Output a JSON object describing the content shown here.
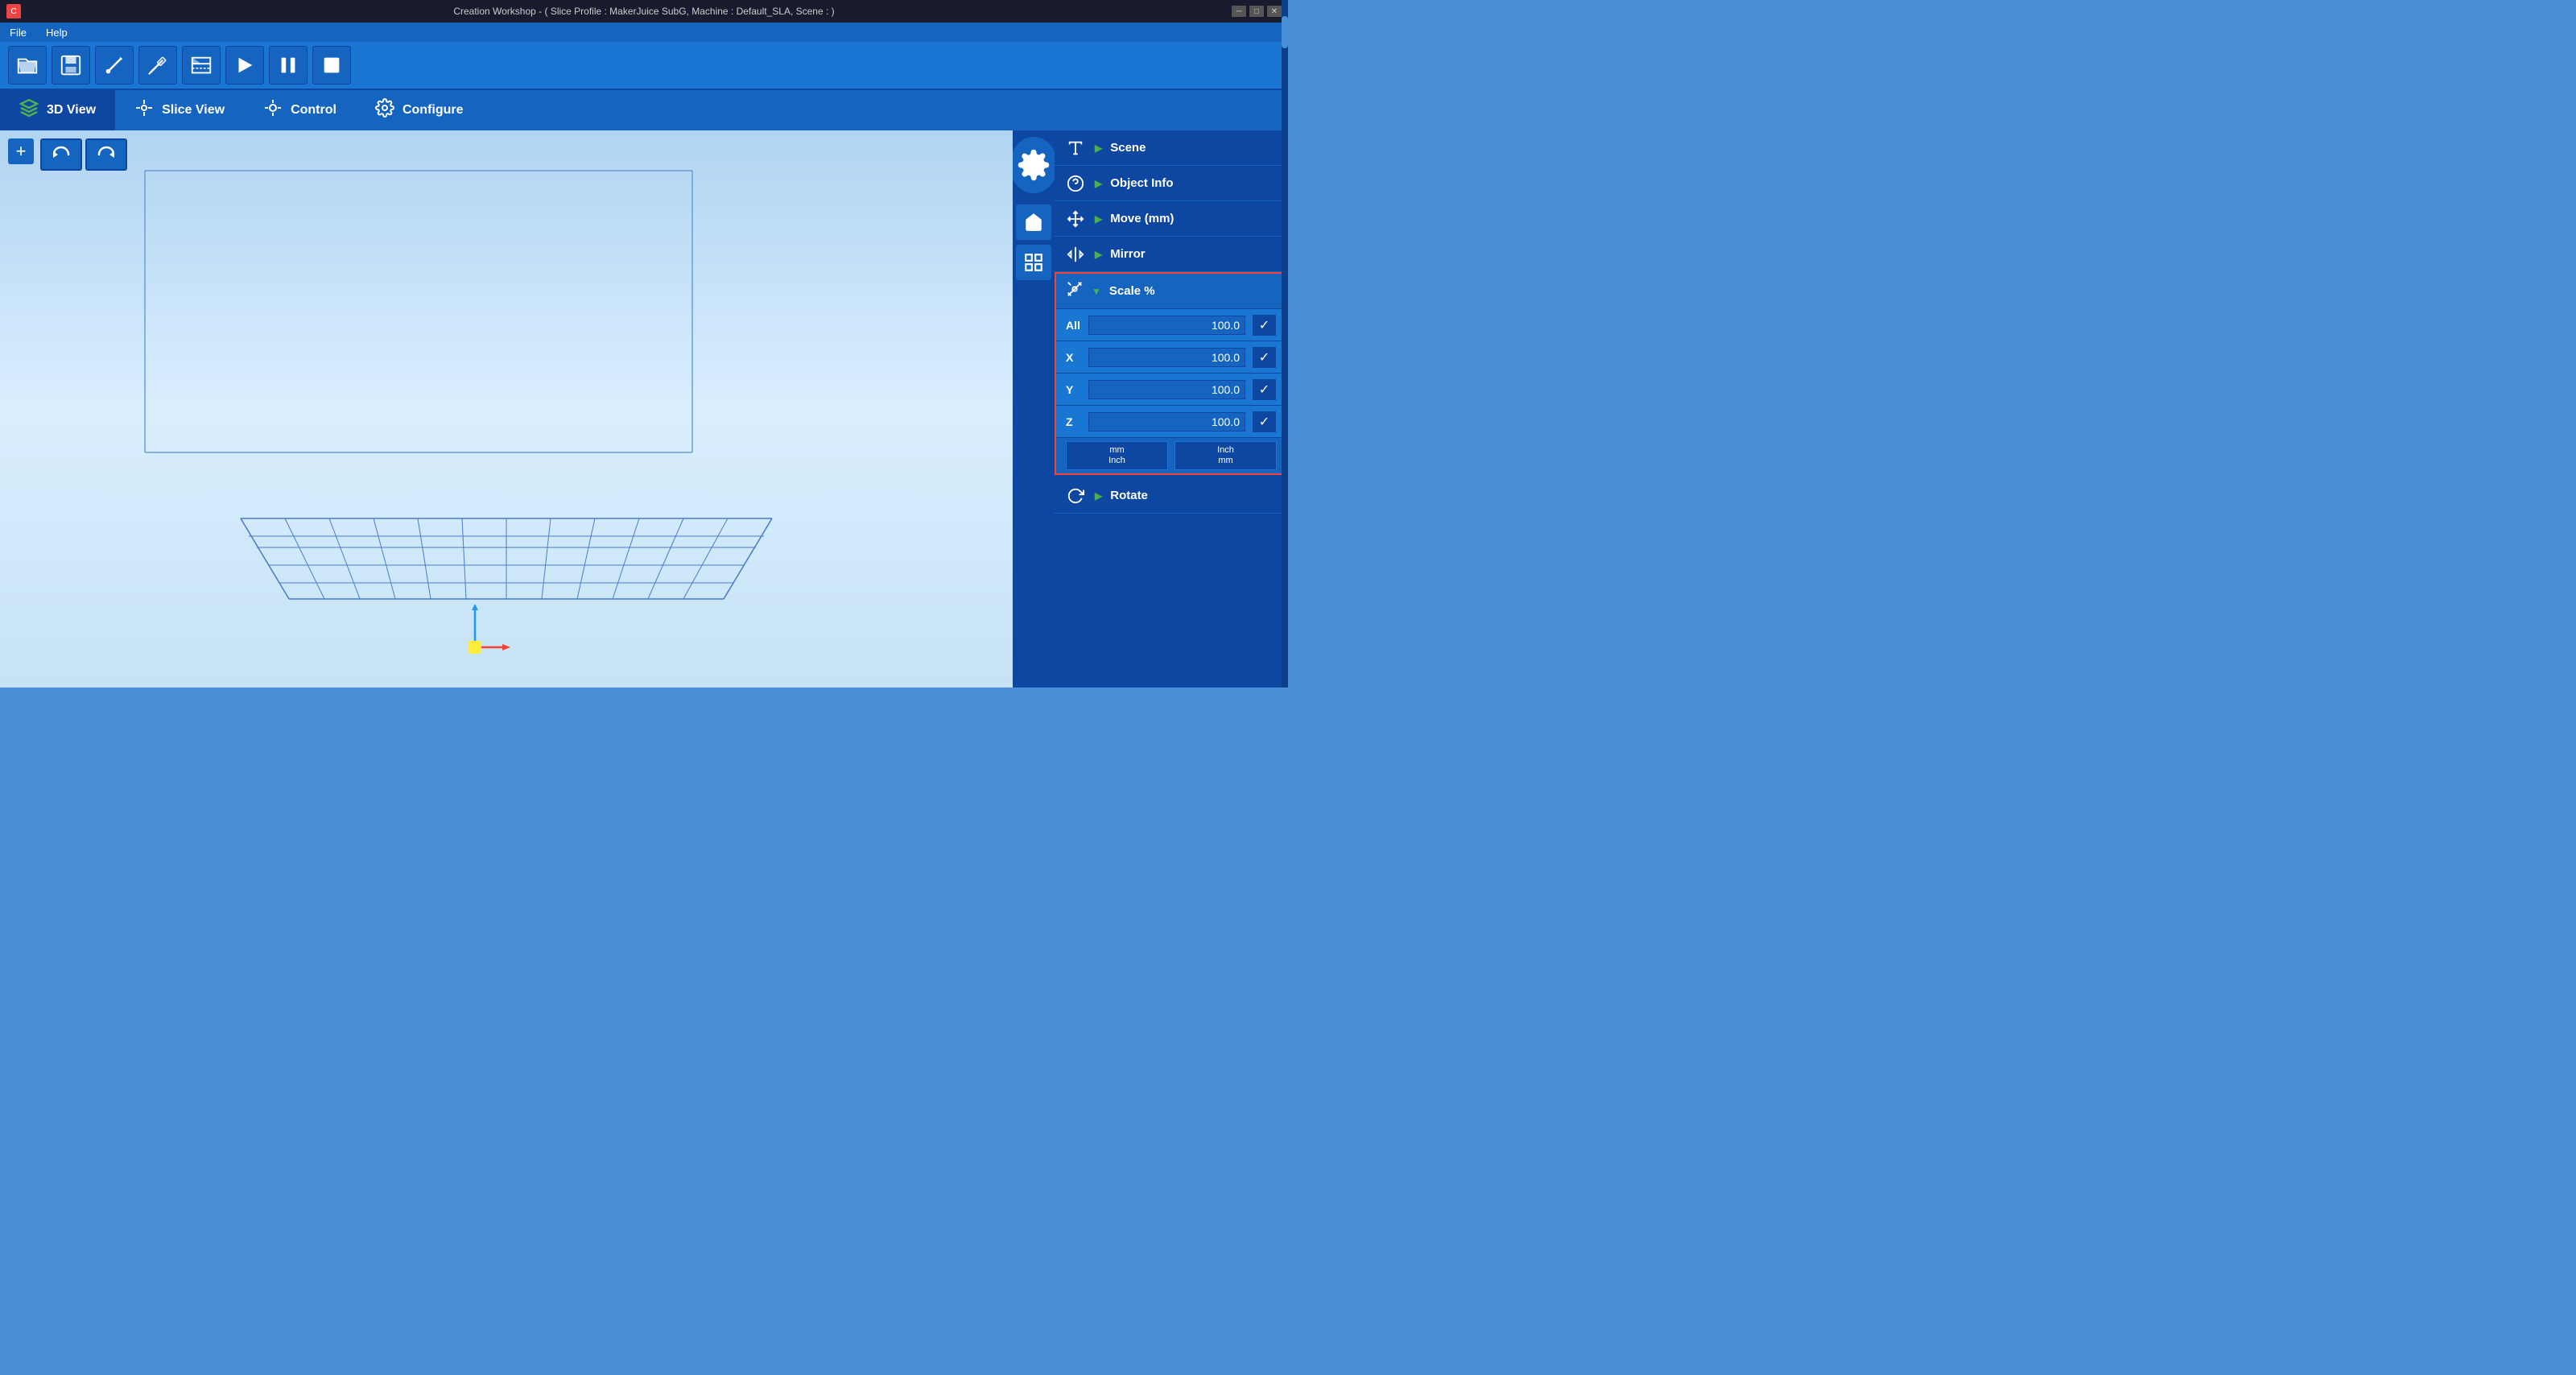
{
  "titlebar": {
    "title": "Creation Workshop -  ( Slice Profile : MakerJuice SubG, Machine : Default_SLA, Scene : )",
    "min_label": "─",
    "max_label": "□",
    "close_label": "✕"
  },
  "menubar": {
    "items": [
      {
        "label": "File",
        "id": "file"
      },
      {
        "label": "Help",
        "id": "help"
      }
    ]
  },
  "toolbar": {
    "buttons": [
      {
        "name": "open-button",
        "icon": "📂"
      },
      {
        "name": "save-button",
        "icon": "💾"
      },
      {
        "name": "needle-tool-button",
        "icon": "🔧"
      },
      {
        "name": "syringe-button",
        "icon": "💉"
      },
      {
        "name": "slice-button",
        "icon": "🔪"
      },
      {
        "name": "play-button",
        "icon": "▶"
      },
      {
        "name": "pause-button",
        "icon": "⏸"
      },
      {
        "name": "stop-button",
        "icon": "⏹"
      }
    ]
  },
  "view_tabs": {
    "tabs": [
      {
        "label": "3D View",
        "id": "3d-view",
        "active": true
      },
      {
        "label": "Slice View",
        "id": "slice-view",
        "active": false
      },
      {
        "label": "Control",
        "id": "control",
        "active": false
      },
      {
        "label": "Configure",
        "id": "configure",
        "active": false
      }
    ]
  },
  "viewport": {
    "add_button_label": "+",
    "undo_tooltip": "Undo",
    "redo_tooltip": "Redo"
  },
  "right_panel": {
    "scene_label": "Scene",
    "object_info_label": "Object Info",
    "move_label": "Move (mm)",
    "mirror_label": "Mirror",
    "scale_label": "Scale %",
    "rotate_label": "Rotate",
    "scale": {
      "all_label": "All",
      "all_value": "100.0",
      "x_label": "X",
      "x_value": "100.0",
      "y_label": "Y",
      "y_value": "100.0",
      "z_label": "Z",
      "z_value": "100.0",
      "unit_mm_inch": "mm\nInch",
      "unit_inch_mm": "Inch\nmm"
    }
  }
}
